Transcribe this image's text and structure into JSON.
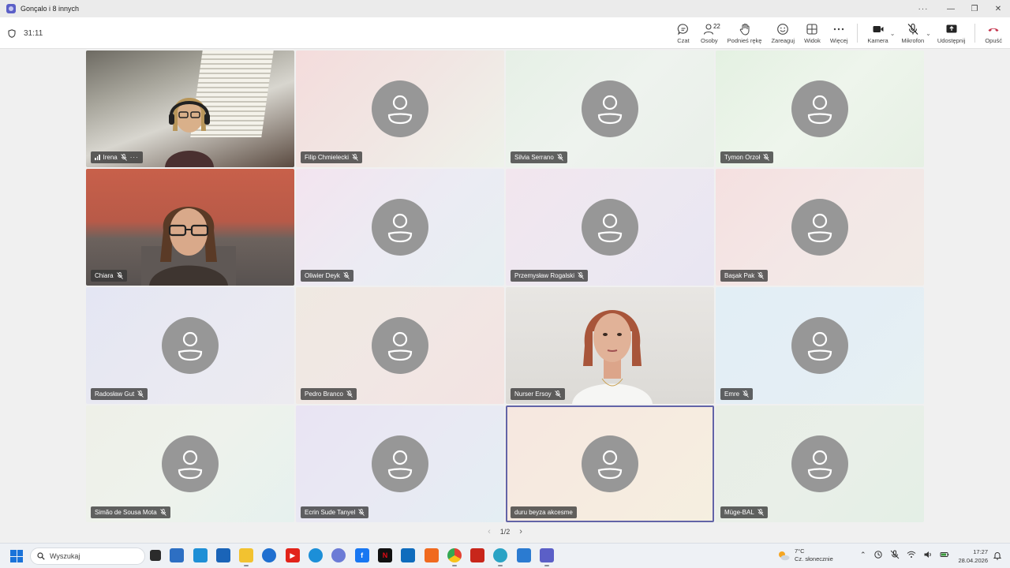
{
  "window": {
    "title": "Gonçalo i 8 innych",
    "more": "···"
  },
  "toolbar": {
    "timer": "31:11",
    "buttons": [
      {
        "id": "chat",
        "label": "Czat",
        "icon": "chat-icon"
      },
      {
        "id": "people",
        "label": "Osoby",
        "count": "22",
        "icon": "people-icon"
      },
      {
        "id": "raise-hand",
        "label": "Podnieś rękę",
        "icon": "hand-icon"
      },
      {
        "id": "react",
        "label": "Zareaguj",
        "icon": "smiley-icon"
      },
      {
        "id": "view",
        "label": "Widok",
        "icon": "grid-icon"
      },
      {
        "id": "more",
        "label": "Więcej",
        "icon": "more-icon"
      },
      {
        "id": "camera",
        "label": "Kamera",
        "icon": "camera-icon"
      },
      {
        "id": "mic",
        "label": "Mikrofon",
        "icon": "mic-off-icon"
      },
      {
        "id": "share",
        "label": "Udostępnij",
        "icon": "share-icon"
      },
      {
        "id": "leave",
        "label": "Opuść",
        "icon": "hangup-icon"
      }
    ]
  },
  "participants": [
    {
      "name": "Irena",
      "video": true
    },
    {
      "name": "Filip Chmielecki",
      "video": false
    },
    {
      "name": "Silvia Serrano",
      "video": false
    },
    {
      "name": "Tymon Orzoł",
      "video": false
    },
    {
      "name": "Chiara",
      "video": true
    },
    {
      "name": "Oliwier Deyk",
      "video": false
    },
    {
      "name": "Przemysław Rogalski",
      "video": false
    },
    {
      "name": "Başak Pak",
      "video": false
    },
    {
      "name": "Radosław Gut",
      "video": false
    },
    {
      "name": "Pedro Branco",
      "video": false
    },
    {
      "name": "Nurser Ersoy",
      "video": true
    },
    {
      "name": "Emre",
      "video": false
    },
    {
      "name": "Simão de Sousa Mota",
      "video": false
    },
    {
      "name": "Ecrin Sude Tanyel",
      "video": false
    },
    {
      "name": "duru beyza akcesme",
      "video": false,
      "active": true
    },
    {
      "name": "Müge-BAL",
      "video": false
    }
  ],
  "pager": {
    "label": "1/2",
    "prev": "‹",
    "next": "›"
  },
  "taskbar": {
    "search_placeholder": "Wyszukaj",
    "weather_temp": "7°C",
    "weather_desc": "Cz. słonecznie",
    "time": "17:27",
    "date": "28.04.2026"
  }
}
